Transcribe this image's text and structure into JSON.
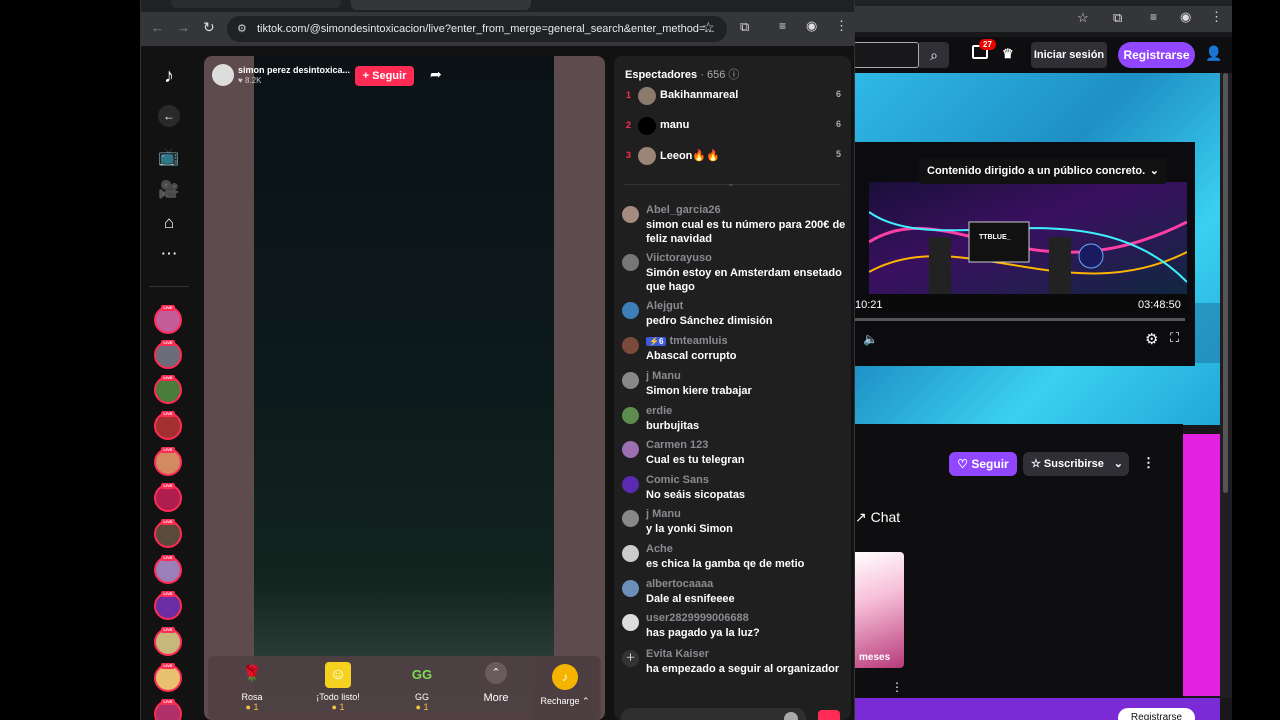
{
  "back_window": {
    "nav": {
      "notifications_count": "27",
      "login_label": "Iniciar sesión",
      "register_label": "Registrarse"
    },
    "player": {
      "age_notice": "Contenido dirigido a un público concreto.",
      "logo_text": "TTBLUE_",
      "elapsed": "10:21",
      "duration": "03:48:50"
    },
    "follow_label": "Seguir",
    "subscribe_label": "Suscribirse",
    "chat_label": "Chat",
    "thumb_caption": "meses",
    "bottom_register": "Registrarse"
  },
  "front_window": {
    "url": "tiktok.com/@simondesintoxicacion/live?enter_from_merge=general_search&enter_method=...",
    "streamer": {
      "name": "simon perez desintoxica...",
      "likes": "8.2K",
      "follow_label": "+ Seguir"
    },
    "viewers_title": "Espectadores",
    "viewers_count": "656",
    "top_viewers": [
      {
        "rank": "1",
        "name": "Bakihanmareal",
        "count": "6"
      },
      {
        "rank": "2",
        "name": "manu",
        "count": "6"
      },
      {
        "rank": "3",
        "name": "Leeon🔥🔥",
        "count": "5"
      }
    ],
    "messages": [
      {
        "user": "Abel_garcia26",
        "text": "simon cual es tu número para 200€ de feliz navidad"
      },
      {
        "user": "Viictorayuso",
        "text": "Simón estoy en Amsterdam ensetado que hago"
      },
      {
        "user": "Alejgut",
        "text": "pedro Sánchez dimisión"
      },
      {
        "user": "tmteamluis",
        "badge": "6",
        "text": "Abascal corrupto"
      },
      {
        "user": "j Manu",
        "text": "Simon kiere trabajar"
      },
      {
        "user": "erdie",
        "text": "burbujitas"
      },
      {
        "user": "Carmen 123",
        "text": "Cual es tu telegran"
      },
      {
        "user": "Comic Sans",
        "text": "No seáis sicopatas"
      },
      {
        "user": "j Manu",
        "text": "y la yonki Simon"
      },
      {
        "user": "Ache",
        "text": "es chica la gamba qe de metio"
      },
      {
        "user": "albertocaaaa",
        "text": "Dale al esnifeeee"
      },
      {
        "user": "user2829999006688",
        "text": "has pagado ya la luz?"
      },
      {
        "user": "Evita Kaiser",
        "text": " ha empezado a seguir al organizador"
      }
    ],
    "gifts": [
      {
        "name": "Rosa",
        "price": "1"
      },
      {
        "name": "¡Todo listo!",
        "price": "1"
      },
      {
        "name": "GG",
        "price": "1"
      }
    ],
    "more_label": "More",
    "recharge_label": "Recharge"
  },
  "colors": {
    "accent": "#fe2c55",
    "twitch": "#9147ff"
  }
}
